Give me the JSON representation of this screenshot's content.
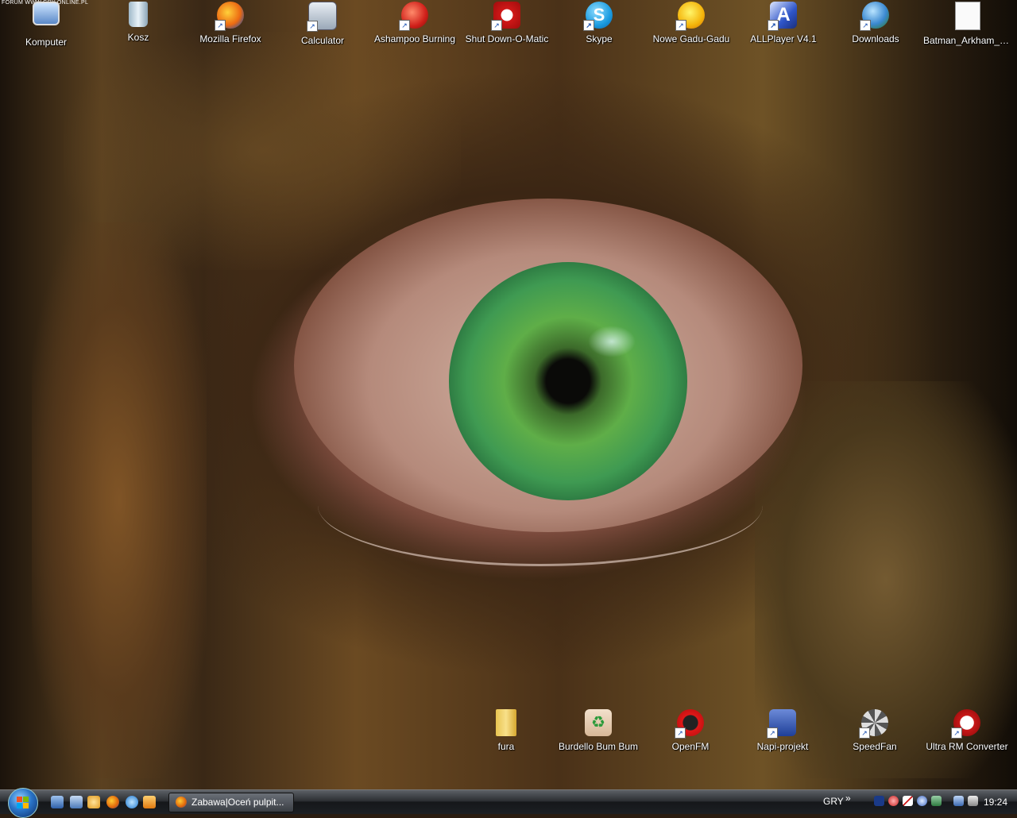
{
  "watermark": "FORUM WWW.GRY-ONLINE.PL",
  "desktop_icons_top": [
    {
      "label": "Komputer",
      "icon": "computer-icon"
    },
    {
      "label": "Kosz",
      "icon": "recycle-bin-icon"
    },
    {
      "label": "Mozilla Firefox",
      "icon": "firefox-icon"
    },
    {
      "label": "Calculator",
      "icon": "calculator-icon"
    },
    {
      "label": "Ashampoo Burning",
      "icon": "ashampoo-burning-icon"
    },
    {
      "label": "Shut Down-O-Matic",
      "icon": "shutdown-icon"
    },
    {
      "label": "Skype",
      "icon": "skype-icon"
    },
    {
      "label": "Nowe Gadu-Gadu",
      "icon": "gadu-gadu-icon"
    },
    {
      "label": "ALLPlayer V4.1",
      "icon": "allplayer-icon"
    },
    {
      "label": "Downloads",
      "icon": "downloads-folder-icon"
    },
    {
      "label": "Batman_Arkham_A...",
      "icon": "document-icon"
    }
  ],
  "desktop_icons_bottom": [
    {
      "label": "fura",
      "icon": "folder-icon"
    },
    {
      "label": "Burdello Bum Bum",
      "icon": "recycle-bag-icon"
    },
    {
      "label": "OpenFM",
      "icon": "openfm-icon"
    },
    {
      "label": "Napi-projekt",
      "icon": "napi-projekt-icon"
    },
    {
      "label": "SpeedFan",
      "icon": "speedfan-icon"
    },
    {
      "label": "Ultra RM Converter",
      "icon": "ultra-rm-converter-icon"
    }
  ],
  "taskbar": {
    "task_button": "Zabawa|Oceń pulpit...",
    "language": "GRY",
    "overflow": "»",
    "clock": "19:24"
  },
  "colors": {
    "taskbar": "#1c1f23",
    "label_text": "#ffffff",
    "iris_green": "#5fae48"
  }
}
